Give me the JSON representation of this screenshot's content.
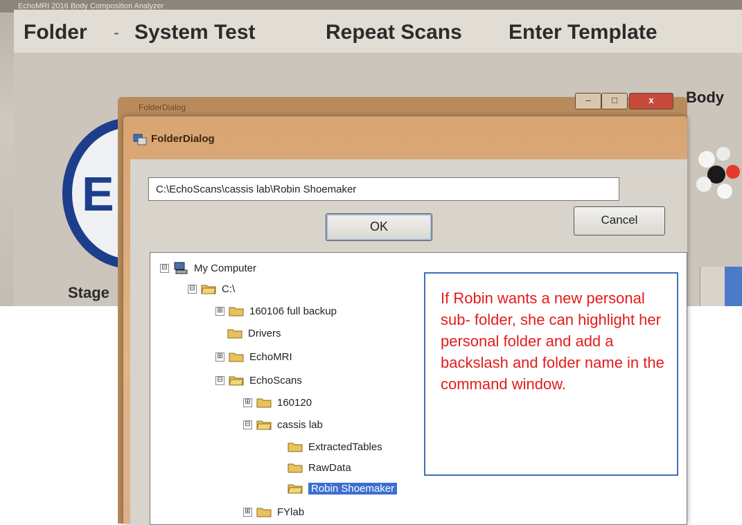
{
  "app": {
    "title": "EchoMRI 2016 Body Composition Analyzer",
    "menu": [
      "Folder",
      "System Test",
      "Repeat Scans",
      "Enter Template"
    ],
    "menu_separator": "-",
    "body_label": "Body",
    "stage_label": "Stage",
    "logo_letter": "E"
  },
  "back_dialog": {
    "title": "FolderDialog"
  },
  "dialog": {
    "title": "FolderDialog",
    "window_buttons": {
      "minimize": "–",
      "maximize": "□",
      "close": "x"
    },
    "path": "C:\\EchoScans\\cassis lab\\Robin Shoemaker",
    "ok_label": "OK",
    "cancel_label": "Cancel"
  },
  "tree": {
    "items": [
      {
        "label": "My Computer",
        "icon": "computer-icon",
        "expander": "⊟"
      },
      {
        "label": "C:\\",
        "icon": "open-folder-icon",
        "expander": "⊟"
      },
      {
        "label": "160106 full backup",
        "icon": "folder-icon",
        "expander": "⊞"
      },
      {
        "label": "Drivers",
        "icon": "folder-icon",
        "expander": ""
      },
      {
        "label": "EchoMRI",
        "icon": "folder-icon",
        "expander": "⊞"
      },
      {
        "label": "EchoScans",
        "icon": "open-folder-icon",
        "expander": "⊟"
      },
      {
        "label": "160120",
        "icon": "folder-icon",
        "expander": "⊞"
      },
      {
        "label": "cassis lab",
        "icon": "open-folder-icon",
        "expander": "⊟"
      },
      {
        "label": "ExtractedTables",
        "icon": "folder-icon",
        "expander": ""
      },
      {
        "label": "RawData",
        "icon": "folder-icon",
        "expander": ""
      },
      {
        "label": "Robin Shoemaker",
        "icon": "open-folder-icon",
        "expander": "",
        "selected": true
      },
      {
        "label": "FYlab",
        "icon": "folder-icon",
        "expander": "⊞"
      }
    ]
  },
  "callout": {
    "text": "If Robin wants a new personal sub- folder, she can highlight her personal folder and add a backslash and folder name in the command window."
  },
  "colors": {
    "dialog_frame": "#dcaa7a",
    "selection": "#3d6fd1",
    "callout_text": "#e31b1b",
    "callout_border": "#3f6fb8",
    "logo_blue": "#1d3e8a"
  }
}
